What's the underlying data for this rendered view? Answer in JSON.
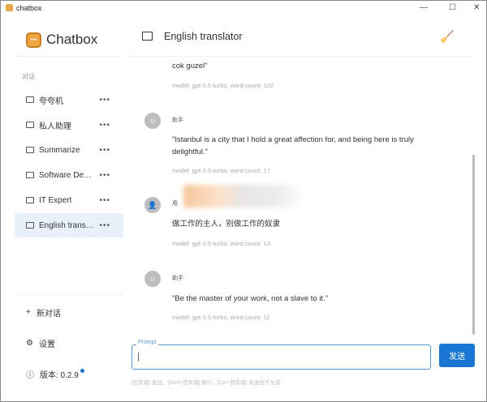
{
  "window": {
    "title": "chatbox",
    "minimize": "—",
    "maximize": "☐",
    "close": "✕"
  },
  "sidebar": {
    "brand": "Chatbox",
    "section": "对话",
    "items": [
      {
        "label": "夸夸机"
      },
      {
        "label": "私人助理"
      },
      {
        "label": "Summarize"
      },
      {
        "label": "Software Developer"
      },
      {
        "label": "IT Expert"
      },
      {
        "label": "English translator",
        "selected": true
      }
    ],
    "new_chat": "新对话",
    "settings": "设置",
    "version": "版本: 0.2.9"
  },
  "header": {
    "title": "English translator"
  },
  "messages": [
    {
      "text": "cok guzel\"",
      "meta": "model: gpt-3.5-turbo, word count: 102"
    },
    {
      "role": "助手",
      "text": "\"Istanbul is a city that I hold a great affection for, and being here is truly delightful.\"",
      "meta": "model: gpt-3.5-turbo, word count: 17"
    },
    {
      "role": "用",
      "text": "做工作的主人，别做工作的奴隶",
      "meta": "model: gpt-3.5-turbo, word count: 13"
    },
    {
      "role": "助手",
      "text": "\"Be the master of your work, not a slave to it.\"",
      "meta": "model: gpt-3.5-turbo, word count: 11"
    }
  ],
  "input": {
    "label": "Prompt",
    "value": "",
    "send": "发送",
    "hint": "[回车键] 发送，[Shift+回车键] 换行，[Ctrl+回车键] 发送但不生成"
  },
  "colors": {
    "accent": "#1976d2",
    "selected": "#e9f2fb"
  }
}
